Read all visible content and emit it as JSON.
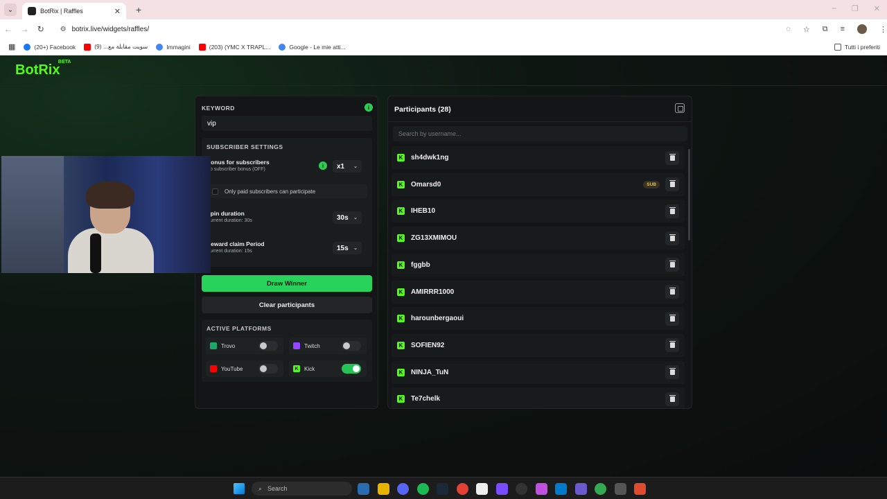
{
  "browser": {
    "tab_title": "BotRix | Raffles",
    "url": "botrix.live/widgets/raffles/",
    "bookmarks": [
      {
        "label": "(20+) Facebook",
        "color": "#1877f2"
      },
      {
        "label": "سويت مقابلة مع... (9)",
        "color": "#ff0000"
      },
      {
        "label": "Immagini",
        "color": "#4285f4"
      },
      {
        "label": "(203) (YMC X TRAPL...",
        "color": "#ff0000"
      },
      {
        "label": "Google - Le mie atti...",
        "color": "#4285f4"
      }
    ],
    "bookmarks_all": "Tutti i preferiti"
  },
  "app": {
    "logo": "BotRix",
    "beta": "BETA",
    "accent": "#53fc18"
  },
  "left": {
    "keyword_label": "KEYWORD",
    "keyword_value": "vip",
    "subscriber_settings_title": "SUBSCRIBER SETTINGS",
    "bonus_name": "Bonus for subscribers",
    "bonus_sub": "No subscriber bonus (OFF)",
    "bonus_value": "x1",
    "only_paid_label": "Only paid subscribers can participate",
    "spin_name": "Spin duration",
    "spin_sub": "Current duration: 30s",
    "spin_value": "30s",
    "reward_name": "Reward claim Period",
    "reward_sub": "Current duration: 15s",
    "reward_value": "15s",
    "draw_label": "Draw Winner",
    "clear_label": "Clear participants",
    "platforms_title": "ACTIVE PLATFORMS",
    "platforms": [
      {
        "name": "Trovo",
        "enabled": false,
        "color": "#1ba86a"
      },
      {
        "name": "Twitch",
        "enabled": false,
        "color": "#9146ff"
      },
      {
        "name": "YouTube",
        "enabled": false,
        "color": "#ff0000"
      },
      {
        "name": "Kick",
        "enabled": true,
        "color": "#53fc18"
      }
    ]
  },
  "right": {
    "title": "Participants (28)",
    "search_placeholder": "Search by username...",
    "participants": [
      {
        "name": "sh4dwk1ng",
        "sub": false
      },
      {
        "name": "Omarsd0",
        "sub": true,
        "badge": "SUB"
      },
      {
        "name": "IHEB10",
        "sub": false
      },
      {
        "name": "ZG13XMIMOU",
        "sub": false
      },
      {
        "name": "fggbb",
        "sub": false
      },
      {
        "name": "AMIRRR1000",
        "sub": false
      },
      {
        "name": "harounbergaoui",
        "sub": false
      },
      {
        "name": "SOFIEN92",
        "sub": false
      },
      {
        "name": "NINJA_TuN",
        "sub": false
      },
      {
        "name": "Te7chelk",
        "sub": false
      }
    ]
  },
  "taskbar": {
    "search_label": "Search"
  }
}
